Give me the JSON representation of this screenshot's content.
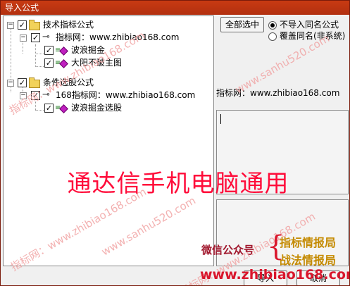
{
  "window": {
    "title": "导入公式"
  },
  "tree": {
    "nodes": [
      {
        "label": "技术指标公式",
        "level": 0,
        "type": "folder",
        "checked": true,
        "expanded": true
      },
      {
        "label": "指标网：www.zhibiao168.com",
        "level": 1,
        "type": "key",
        "checked": true,
        "expanded": true
      },
      {
        "label": "波浪掘金",
        "level": 2,
        "type": "leaf",
        "checked": true
      },
      {
        "label": "大阳不破主图",
        "level": 2,
        "type": "leaf",
        "checked": true
      },
      {
        "label": "条件选股公式",
        "level": 0,
        "type": "folder",
        "checked": true,
        "expanded": true
      },
      {
        "label": "168指标网：www.zhibiao168.com",
        "level": 1,
        "type": "key",
        "checked": true,
        "expanded": true
      },
      {
        "label": "波浪掘金选股",
        "level": 2,
        "type": "leaf",
        "checked": true
      }
    ]
  },
  "controls": {
    "select_all_label": "全部选中",
    "options": [
      {
        "label": "不导入同名公式",
        "selected": true
      },
      {
        "label": "覆盖同名(非系统)",
        "selected": false
      }
    ],
    "source_text": "指标网：www.zhibiao168.com",
    "ok_label": "导入",
    "cancel_label": "取消"
  },
  "overlays": {
    "headline": "通达信手机电脑通用",
    "wechat_label": "微信公众号",
    "account_1": "指标情报局",
    "account_2": "战法情报局",
    "site": "www.zhibiao168.com",
    "watermark_a": "www.sanhu520.com",
    "watermark_b": "指标网：www.zhibiao168.com"
  },
  "colors": {
    "titlebar": "#c0360f",
    "headline": "#ff0c3a",
    "wechat": "#a0162c",
    "gold": "#c48a00",
    "watermark": "#f1a4a4"
  }
}
